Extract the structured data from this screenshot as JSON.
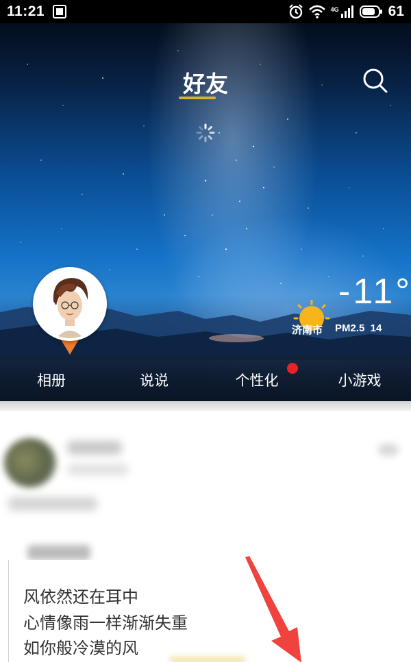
{
  "status_bar": {
    "time": "11:21",
    "network_label": "4G",
    "battery_level": "61"
  },
  "header": {
    "title": "好友",
    "accent_color": "#d6b230"
  },
  "weather": {
    "temperature": "-11°",
    "city": "济南市",
    "air_quality": "PM2.5  14"
  },
  "tabs": [
    {
      "label": "相册"
    },
    {
      "label": "说说"
    },
    {
      "label": "个性化",
      "badge_color": "#e8222a"
    },
    {
      "label": "小游戏"
    }
  ],
  "feed": {
    "poem_lines": [
      "风依然还在耳中",
      "心情像雨一样渐渐失重",
      "如你般冷漠的风"
    ]
  },
  "annotation": {
    "arrow_color": "#f0433d"
  }
}
